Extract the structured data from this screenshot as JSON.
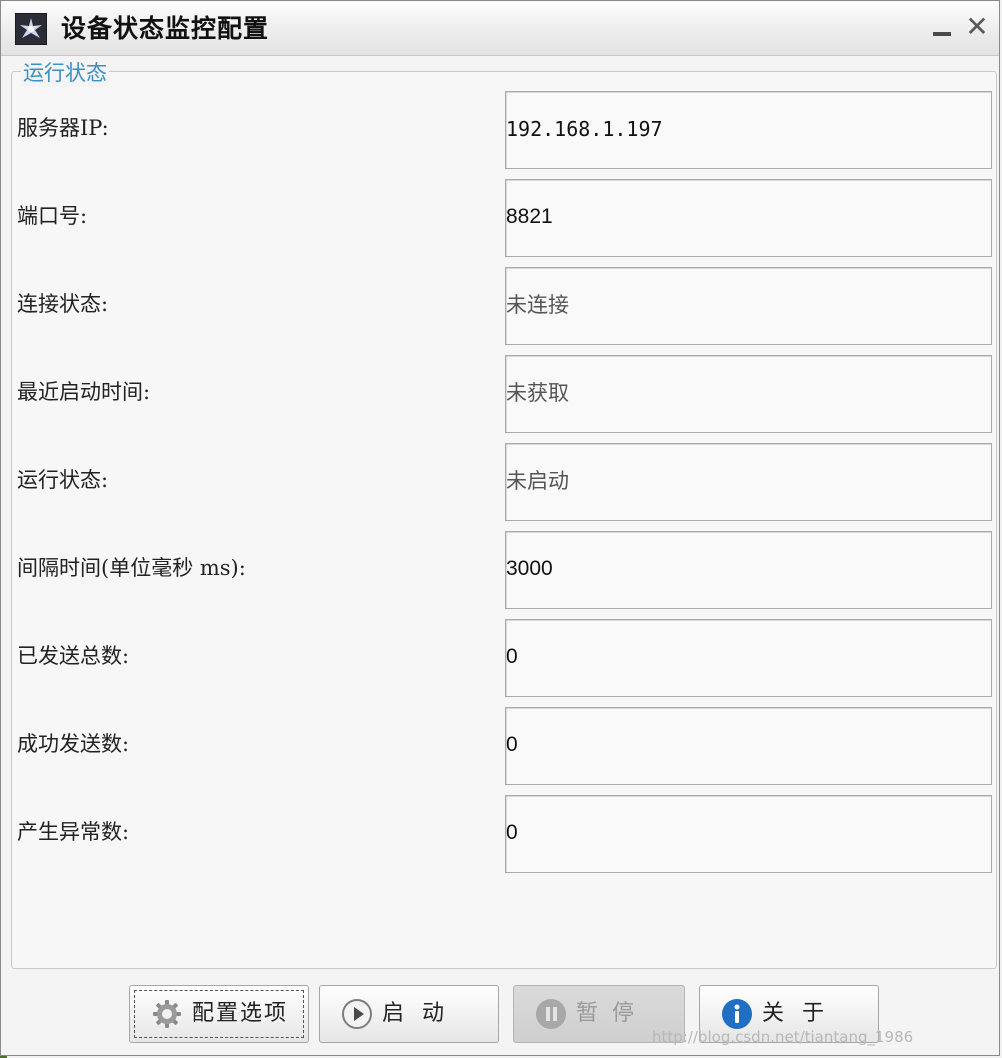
{
  "window": {
    "title": "设备状态监控配置",
    "app_icon": "app-logo-icon",
    "minimize_icon": "minimize-icon",
    "close_icon": "close-icon",
    "close_glyph": "✕"
  },
  "group": {
    "legend": "运行状态"
  },
  "fields": [
    {
      "label": "服务器IP:",
      "value": "192.168.1.197"
    },
    {
      "label": "端口号:",
      "value": "8821"
    },
    {
      "label": "连接状态:",
      "value": "未连接"
    },
    {
      "label": "最近启动时间:",
      "value": "未获取"
    },
    {
      "label": "运行状态:",
      "value": "未启动"
    },
    {
      "label": "间隔时间(单位毫秒 ms):",
      "value": "3000"
    },
    {
      "label": "已发送总数:",
      "value": "0"
    },
    {
      "label": "成功发送数:",
      "value": "0"
    },
    {
      "label": "产生异常数:",
      "value": "0"
    }
  ],
  "buttons": {
    "config": {
      "label": "配置选项",
      "icon": "gear-icon"
    },
    "start": {
      "label": "启动",
      "icon": "play-icon"
    },
    "pause": {
      "label": "暂停",
      "icon": "pause-icon",
      "disabled": true
    },
    "about": {
      "label": "关于",
      "icon": "info-icon"
    }
  },
  "watermark": "http://blog.csdn.net/tiantang_1986",
  "colors": {
    "legend_text": "#3c8fc0",
    "info_icon": "#1f6fc4",
    "disabled_text": "#9a9a9a"
  }
}
